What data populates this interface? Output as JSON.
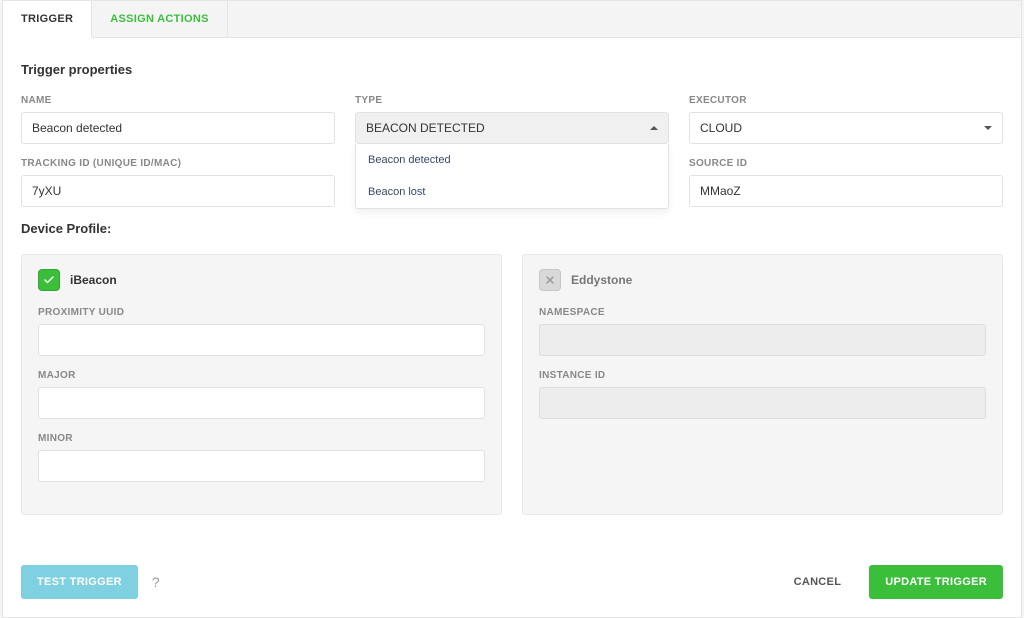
{
  "tabs": {
    "trigger": "TRIGGER",
    "assign_actions": "ASSIGN ACTIONS"
  },
  "section": {
    "title": "Trigger properties",
    "device_profile": "Device Profile:"
  },
  "fields": {
    "name": {
      "label": "NAME",
      "value": "Beacon detected"
    },
    "type": {
      "label": "TYPE",
      "selected": "BEACON DETECTED",
      "options": [
        "Beacon detected",
        "Beacon lost"
      ]
    },
    "executor": {
      "label": "EXECUTOR",
      "selected": "CLOUD"
    },
    "tracking_id": {
      "label": "TRACKING ID (UNIQUE ID/MAC)",
      "value": "7yXU"
    },
    "source_id": {
      "label": "SOURCE ID",
      "value": "MMaoZ"
    }
  },
  "ibeacon": {
    "title": "iBeacon",
    "checked": true,
    "proximity_uuid": {
      "label": "PROXIMITY UUID",
      "value": ""
    },
    "major": {
      "label": "MAJOR",
      "value": ""
    },
    "minor": {
      "label": "MINOR",
      "value": ""
    }
  },
  "eddystone": {
    "title": "Eddystone",
    "checked": false,
    "namespace": {
      "label": "NAMESPACE",
      "value": ""
    },
    "instance_id": {
      "label": "INSTANCE ID",
      "value": ""
    }
  },
  "footer": {
    "test": "TEST TRIGGER",
    "help": "?",
    "cancel": "CANCEL",
    "update": "UPDATE TRIGGER"
  }
}
